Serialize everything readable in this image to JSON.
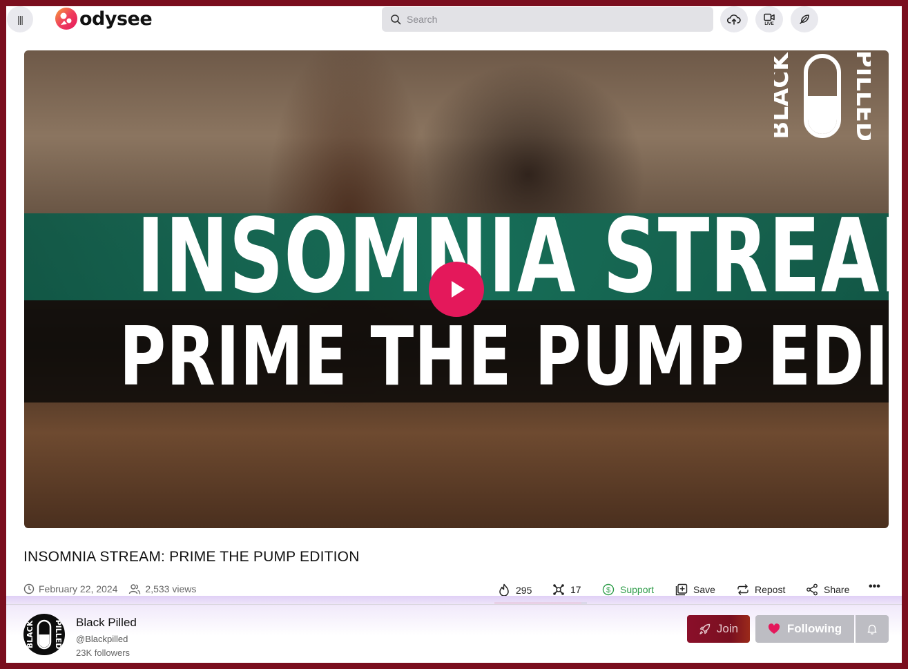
{
  "header": {
    "logo_text": "odysee",
    "search_placeholder": "Search",
    "live_label": "LIVE"
  },
  "player": {
    "thumbnail_line1": "INSOMNIA STREAM",
    "thumbnail_line2": "PRIME THE PUMP EDITION",
    "channel_logo_text_left": "BLACK",
    "channel_logo_text_right": "PILLED"
  },
  "video": {
    "title": "INSOMNIA STREAM: PRIME THE PUMP EDITION",
    "date": "February 22, 2024",
    "views": "2,533 views",
    "likes": "295",
    "dislikes": "17",
    "like_ratio": 0.94,
    "actions": {
      "support": "Support",
      "save": "Save",
      "repost": "Repost",
      "share": "Share",
      "more": "•••"
    }
  },
  "channel": {
    "name": "Black Pilled",
    "handle": "@Blackpilled",
    "followers": "23K followers",
    "join_label": "Join",
    "following_label": "Following"
  },
  "colors": {
    "accent": "#e4185b",
    "support": "#2f9d4a",
    "join": "#7a1020",
    "frame": "#7a0e1e"
  }
}
